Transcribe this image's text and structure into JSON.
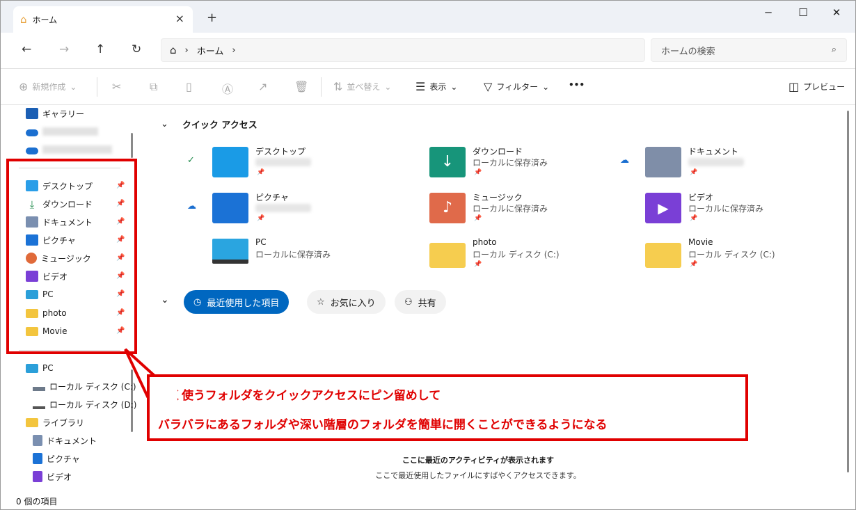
{
  "window": {
    "tab_title": "ホーム",
    "tab_close": "×",
    "new_tab": "+",
    "minimize": "−",
    "maximize": "☐",
    "close": "✕"
  },
  "address": {
    "path": [
      "ホーム"
    ],
    "search_placeholder": "ホームの検索"
  },
  "toolbar": {
    "new": "新規作成",
    "sort": "並べ替え",
    "view": "表示",
    "filter": "フィルター",
    "more": "•••",
    "preview": "プレビュー"
  },
  "sidebar": {
    "gallery": "ギャラリー",
    "pinned": [
      "デスクトップ",
      "ダウンロード",
      "ドキュメント",
      "ピクチャ",
      "ミュージック",
      "ビデオ",
      "PC",
      "photo",
      "Movie"
    ],
    "pc": "PC",
    "drive_c": "ローカル ディスク (C:)",
    "drive_d": "ローカル ディスク (D:)",
    "libraries": "ライブラリ",
    "lib_items": [
      "ドキュメント",
      "ピクチャ",
      "ビデオ"
    ]
  },
  "quick_access": {
    "header": "クイック アクセス",
    "items": [
      {
        "name": "デスクトップ",
        "sub": ""
      },
      {
        "name": "ダウンロード",
        "sub": "ローカルに保存済み"
      },
      {
        "name": "ドキュメント",
        "sub": ""
      },
      {
        "name": "ピクチャ",
        "sub": ""
      },
      {
        "name": "ミュージック",
        "sub": "ローカルに保存済み"
      },
      {
        "name": "ビデオ",
        "sub": "ローカルに保存済み"
      },
      {
        "name": "PC",
        "sub": "ローカルに保存済み"
      },
      {
        "name": "photo",
        "sub": "ローカル ディスク (C:)"
      },
      {
        "name": "Movie",
        "sub": "ローカル ディスク (C:)"
      }
    ]
  },
  "recent_tabs": {
    "recent": "最近使用した項目",
    "favorites": "お気に入り",
    "shared": "共有"
  },
  "empty_state": {
    "title": "ここに最近のアクティビティが表示されます",
    "desc": "ここで最近使用したファイルにすばやくアクセスできます。"
  },
  "status": {
    "count": "0 個の項目"
  },
  "annotation": {
    "line1": "よく使うフォルダをクイックアクセスにピン留めして",
    "line2": "バラバラにあるフォルダや深い階層のフォルダを簡単に開くことができるようになる"
  },
  "colors": {
    "accent": "#0067c0",
    "annotation_red": "#e00000"
  }
}
